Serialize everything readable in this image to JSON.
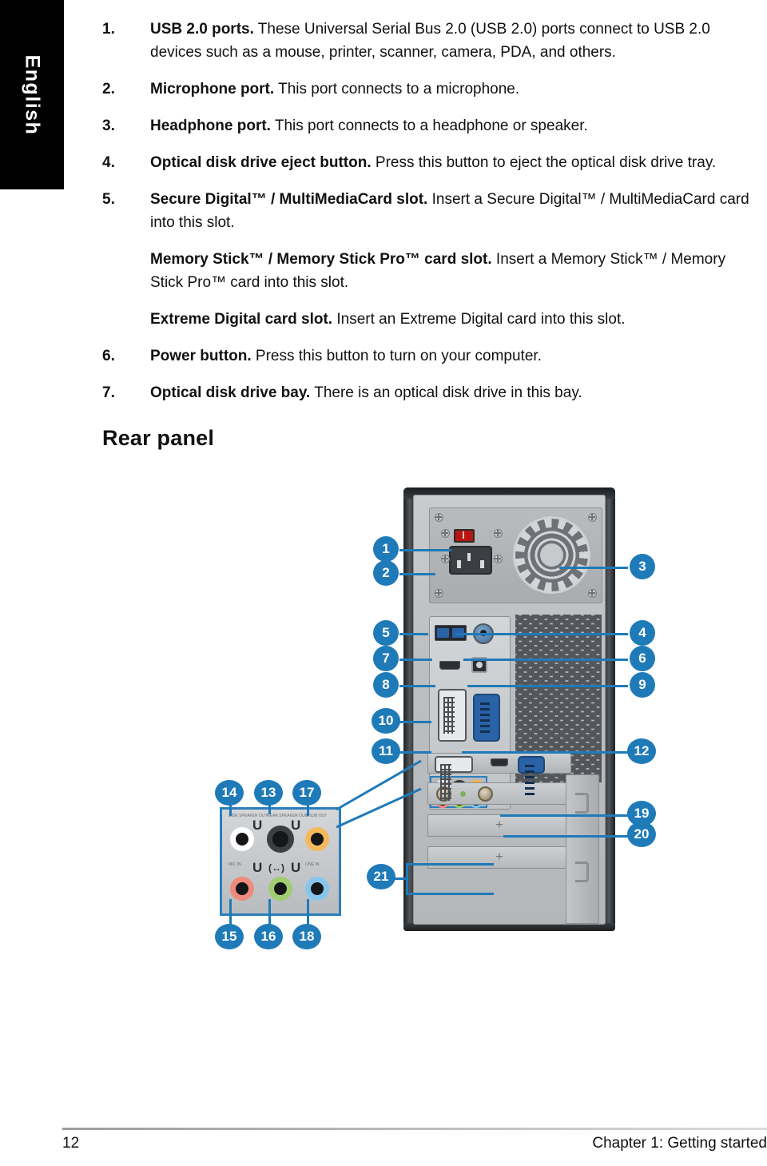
{
  "language_tab": {
    "label": "English"
  },
  "list": [
    {
      "num": "1.",
      "title": "USB 2.0 ports.",
      "body": " These Universal Serial Bus 2.0 (USB 2.0) ports connect to USB 2.0 devices such as a mouse, printer, scanner, camera, PDA, and others."
    },
    {
      "num": "2.",
      "title": "Microphone port.",
      "body": " This port connects to a microphone."
    },
    {
      "num": "3.",
      "title": "Headphone port.",
      "body": " This port connects to a headphone or speaker."
    },
    {
      "num": "4.",
      "title": "Optical disk drive eject button.",
      "body": " Press this button to eject the optical disk drive tray."
    },
    {
      "num": "5.",
      "title": "Secure Digital™ / MultiMediaCard slot.",
      "body": " Insert a Secure Digital™ / MultiMediaCard card into this slot.",
      "extra": [
        {
          "title": "Memory Stick™ / Memory Stick Pro™ card slot.",
          "body": " Insert a Memory Stick™ / Memory Stick Pro™ card into this slot."
        },
        {
          "title": "Extreme Digital card slot.",
          "body": " Insert an Extreme Digital card into this slot."
        }
      ]
    },
    {
      "num": "6.",
      "title": "Power button.",
      "body": " Press this button to turn on your computer."
    },
    {
      "num": "7.",
      "title": "Optical disk drive bay.",
      "body": " There is an optical disk drive in this bay."
    }
  ],
  "section": {
    "heading": "Rear panel"
  },
  "figure": {
    "callouts": {
      "c1": "1",
      "c2": "2",
      "c3": "3",
      "c4": "4",
      "c5": "5",
      "c6": "6",
      "c7": "7",
      "c8": "8",
      "c9": "9",
      "c10": "10",
      "c11": "11",
      "c12": "12",
      "c13": "13",
      "c14": "14",
      "c15": "15",
      "c16": "16",
      "c17": "17",
      "c18": "18",
      "c19": "19",
      "c20": "20",
      "c21": "21"
    },
    "audio_panel": {
      "ports": [
        {
          "callout": "14",
          "color": "#ffffff",
          "name": "side-speaker-out-port"
        },
        {
          "callout": "13",
          "color": "#3c3f42",
          "name": "rear-speaker-out-port"
        },
        {
          "callout": "17",
          "color": "#f3b95c",
          "name": "center-subwoofer-port"
        },
        {
          "callout": "15",
          "color": "#ef8b7c",
          "name": "microphone-port"
        },
        {
          "callout": "16",
          "color": "#a0cd72",
          "name": "line-out-port"
        },
        {
          "callout": "18",
          "color": "#86c6ec",
          "name": "line-in-port"
        }
      ],
      "glyphs": [
        "U",
        "U",
        "U",
        "U"
      ]
    },
    "accent_color": "#1f7ab8",
    "expansion_slot_marks": [
      "+",
      "+"
    ]
  },
  "footer": {
    "page_number": "12",
    "chapter": "Chapter 1: Getting started"
  }
}
